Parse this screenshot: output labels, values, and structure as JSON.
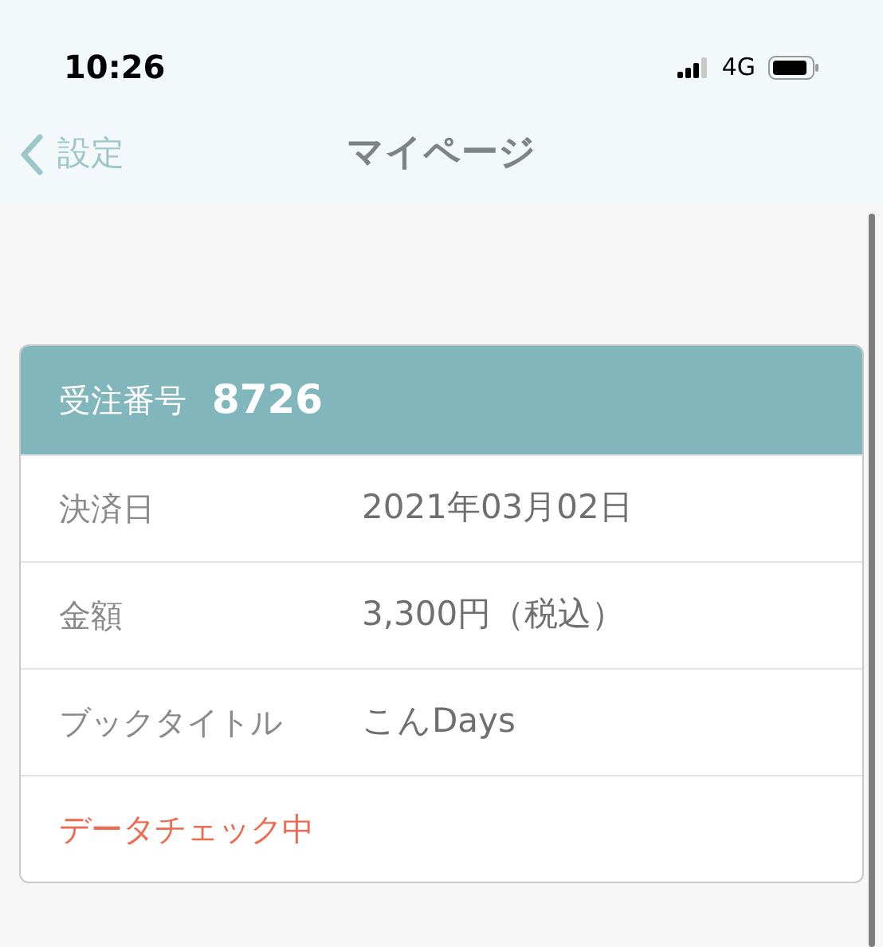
{
  "status_bar": {
    "time": "10:26",
    "network": "4G"
  },
  "nav_bar": {
    "back_label": "設定",
    "title": "マイページ"
  },
  "order_card": {
    "header_label": "受注番号",
    "order_number": "8726",
    "rows": [
      {
        "kind": "field",
        "label": "決済日",
        "value": "2021年03月02日"
      },
      {
        "kind": "field",
        "label": "金額",
        "value": "3,300円（税込）"
      },
      {
        "kind": "field",
        "label": "ブックタイトル",
        "value": "こんDays"
      },
      {
        "kind": "status",
        "label": "データチェック中"
      }
    ]
  }
}
